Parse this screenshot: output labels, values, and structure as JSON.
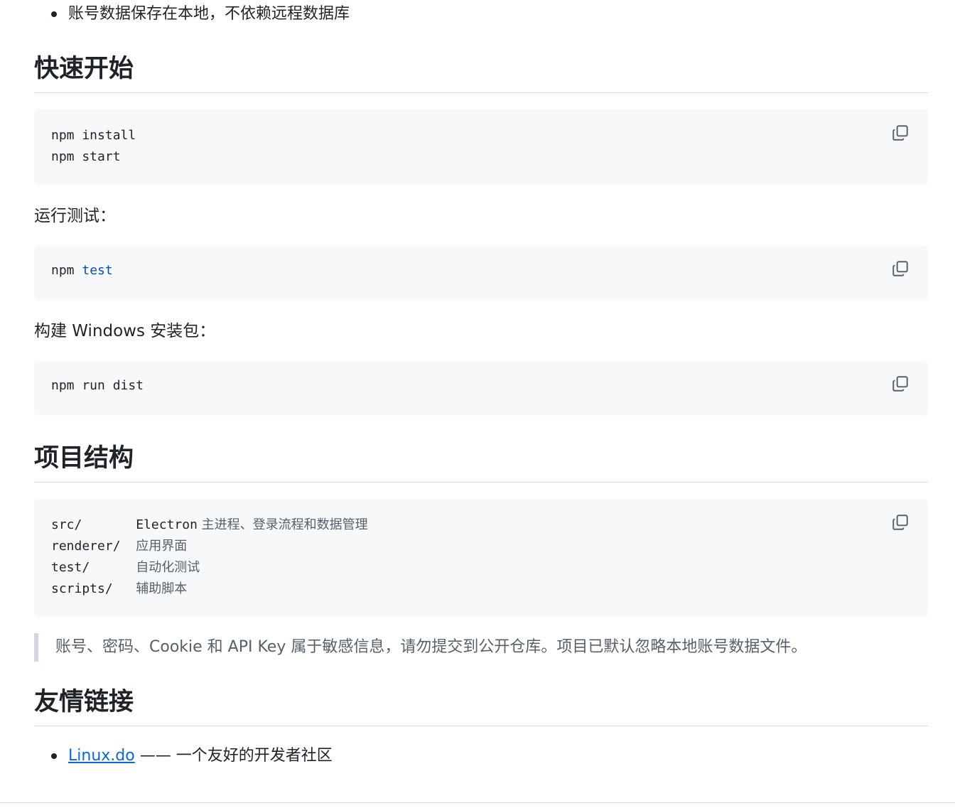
{
  "intro_bullet": "账号数据保存在本地，不依赖远程数据库",
  "quickstart": {
    "heading": "快速开始",
    "install_lines": [
      "npm install",
      "npm start"
    ],
    "test_label": "运行测试：",
    "test_cmd": {
      "prefix": "npm ",
      "keyword": "test"
    },
    "build_label": "构建 Windows 安装包：",
    "build_cmd": "npm run dist"
  },
  "structure": {
    "heading": "项目结构",
    "rows": [
      {
        "path": "src/       ",
        "mono_desc": "Electron",
        "desc": " 主进程、登录流程和数据管理"
      },
      {
        "path": "renderer/  ",
        "mono_desc": "",
        "desc": "应用界面"
      },
      {
        "path": "test/      ",
        "mono_desc": "",
        "desc": "自动化测试"
      },
      {
        "path": "scripts/   ",
        "mono_desc": "",
        "desc": "辅助脚本"
      }
    ]
  },
  "notice": "账号、密码、Cookie 和 API Key 属于敏感信息，请勿提交到公开仓库。项目已默认忽略本地账号数据文件。",
  "links": {
    "heading": "友情链接",
    "items": [
      {
        "label": "Linux.do",
        "suffix": " —— 一个友好的开发者社区"
      }
    ]
  },
  "icons": {
    "copy": "copy-icon"
  },
  "colors": {
    "link": "#0969da",
    "keyword": "#0550ae",
    "code_bg": "#f6f8fa"
  }
}
